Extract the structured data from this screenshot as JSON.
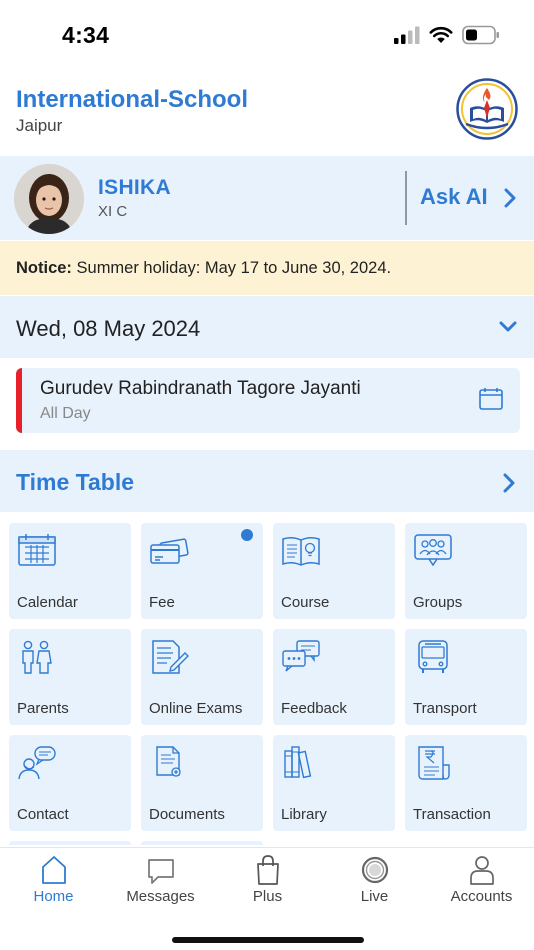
{
  "status_bar": {
    "time": "4:34"
  },
  "school": {
    "name": "International-School",
    "city": "Jaipur"
  },
  "student": {
    "name": "ISHIKA",
    "class": "XI C"
  },
  "ask_ai": {
    "label": "Ask AI"
  },
  "notice": {
    "prefix": "Notice:",
    "text": " Summer holiday: May 17 to June 30, 2024."
  },
  "date": {
    "label": "Wed, 08 May 2024"
  },
  "event": {
    "title": "Gurudev Rabindranath Tagore Jayanti",
    "time": "All Day"
  },
  "timetable": {
    "title": "Time Table"
  },
  "tiles": [
    {
      "label": "Calendar",
      "icon": "calendar-icon"
    },
    {
      "label": "Fee",
      "icon": "fee-cards-icon",
      "badge": true
    },
    {
      "label": "Course",
      "icon": "course-book-icon"
    },
    {
      "label": "Groups",
      "icon": "groups-icon"
    },
    {
      "label": "Parents",
      "icon": "parents-icon"
    },
    {
      "label": "Online Exams",
      "icon": "online-exams-icon"
    },
    {
      "label": "Feedback",
      "icon": "feedback-icon"
    },
    {
      "label": "Transport",
      "icon": "bus-icon"
    },
    {
      "label": "Contact",
      "icon": "contact-icon"
    },
    {
      "label": "Documents",
      "icon": "documents-icon"
    },
    {
      "label": "Library",
      "icon": "library-books-icon"
    },
    {
      "label": "Transaction",
      "icon": "transaction-receipt-icon"
    }
  ],
  "tabs": [
    {
      "label": "Home",
      "icon": "home-icon",
      "active": true
    },
    {
      "label": "Messages",
      "icon": "messages-icon"
    },
    {
      "label": "Plus",
      "icon": "shopping-bag-icon"
    },
    {
      "label": "Live",
      "icon": "live-icon"
    },
    {
      "label": "Accounts",
      "icon": "account-icon"
    }
  ],
  "colors": {
    "accent": "#2f7bd3",
    "tile_bg": "#e8f2fc",
    "notice_bg": "#fdf3d4",
    "event_bar": "#e8202a"
  }
}
